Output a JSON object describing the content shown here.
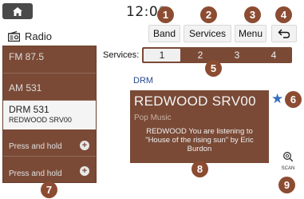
{
  "header": {
    "clock_main": "12:0",
    "clock_dim": "0"
  },
  "title": {
    "icon": "radio-icon",
    "label": "Radio"
  },
  "toolbar": {
    "band_label": "Band",
    "services_label": "Services",
    "menu_label": "Menu",
    "back_icon": "back-arrow-icon"
  },
  "stations": [
    {
      "name": "FM 87.5",
      "sub": ""
    },
    {
      "name": "AM 531",
      "sub": ""
    },
    {
      "name": "DRM 531",
      "sub": "REDWOOD SRV00"
    },
    {
      "name": "Press and hold",
      "sub": ""
    },
    {
      "name": "Press and hold",
      "sub": ""
    }
  ],
  "services": {
    "label": "Services",
    "items": [
      "1",
      "2",
      "3",
      "4"
    ],
    "active_index": 0
  },
  "band_label": "DRM",
  "now_playing": {
    "title": "REDWOOD SRV00",
    "genre": "Pop Music",
    "text": "REDWOOD You are listening to \"House of the rising sun\" by Eric Burdon"
  },
  "scan_label": "SCAN",
  "callouts": [
    "1",
    "2",
    "3",
    "4",
    "5",
    "6",
    "7",
    "8",
    "9"
  ],
  "colors": {
    "panel": "#7a4a36",
    "callout": "#8c4c32",
    "accent_blue": "#3a6fbd"
  }
}
